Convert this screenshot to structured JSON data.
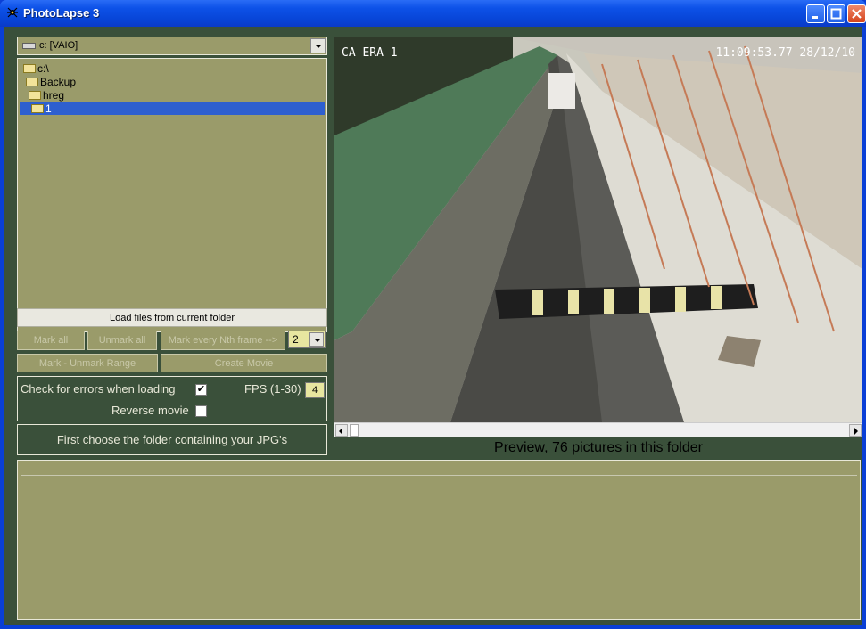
{
  "window": {
    "title": "PhotoLapse 3"
  },
  "drive": {
    "selected": "c: [VAIO]"
  },
  "folder_tree": [
    {
      "label": "c:\\",
      "indent": 0,
      "selected": false
    },
    {
      "label": "Backup",
      "indent": 1,
      "selected": false
    },
    {
      "label": "hreg",
      "indent": 2,
      "selected": false
    },
    {
      "label": "1",
      "indent": 3,
      "selected": true
    }
  ],
  "buttons": {
    "load_files": "Load files from current folder",
    "mark_all": "Mark all",
    "unmark_all": "Unmark all",
    "mark_every_nth": "Mark every Nth frame -->",
    "mark_unmark_range": "Mark - Unmark Range",
    "create_movie": "Create Movie"
  },
  "nth_frame": {
    "value": "2"
  },
  "options": {
    "check_errors_label": "Check for errors when loading",
    "check_errors": true,
    "fps_label": "FPS (1-30)",
    "fps_value": "4",
    "reverse_label": "Reverse movie",
    "reverse": false
  },
  "status_message": "First choose the folder containing your JPG's",
  "preview": {
    "camera_label": "CA ERA 1",
    "timestamp": "11:09:53.77 28/12/10",
    "caption": "Preview, 76 pictures in this folder"
  }
}
